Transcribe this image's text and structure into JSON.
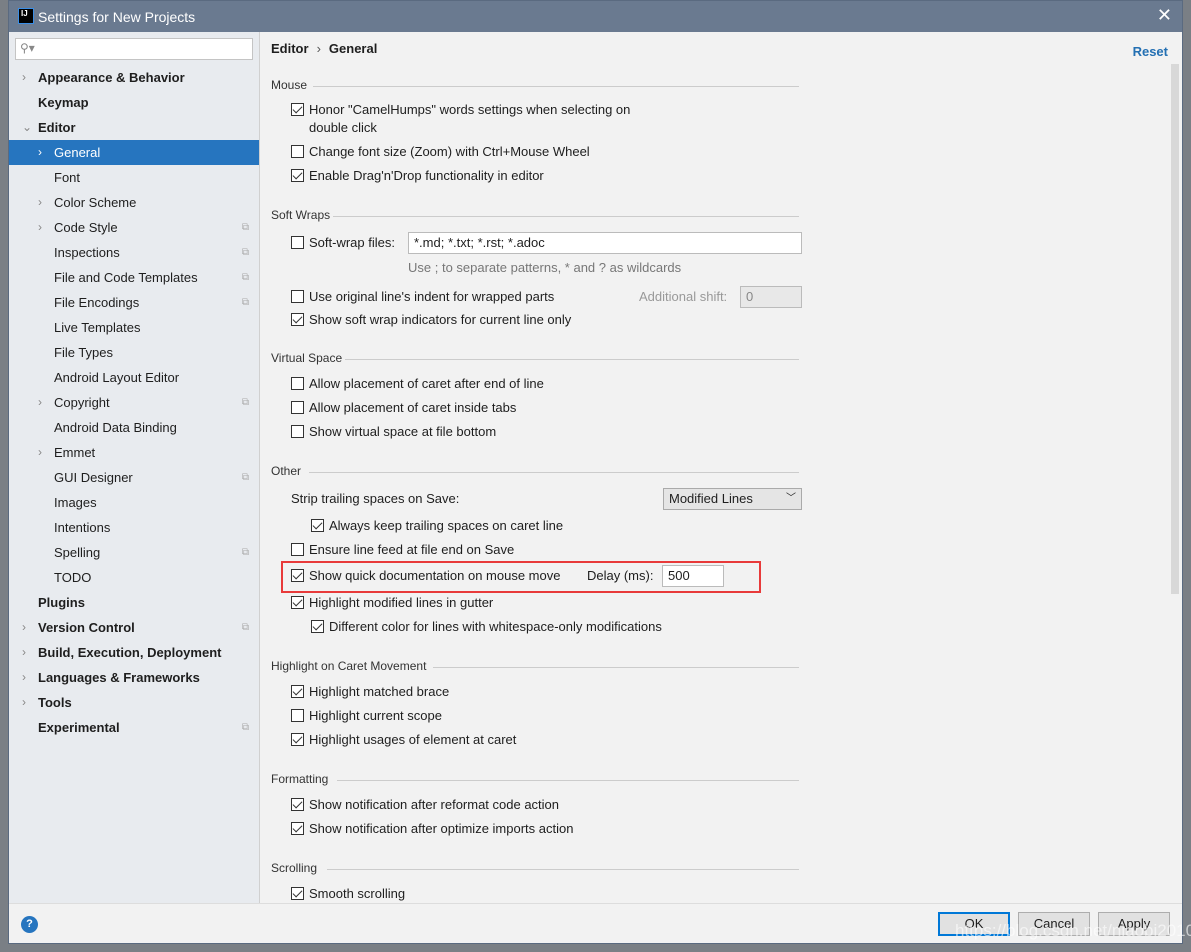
{
  "window": {
    "title": "Settings for New Projects",
    "logo": "IJ",
    "close": "✕"
  },
  "search": {
    "placeholder": "",
    "icon": "search-icon"
  },
  "sidebar": {
    "items": [
      {
        "label": "Appearance & Behavior",
        "bold": true,
        "arrow": "›",
        "level": 0
      },
      {
        "label": "Keymap",
        "bold": true,
        "arrow": "",
        "level": 0
      },
      {
        "label": "Editor",
        "bold": true,
        "arrow": "⌄",
        "level": 0
      },
      {
        "label": "General",
        "arrow": "›",
        "level": 1,
        "selected": true
      },
      {
        "label": "Font",
        "arrow": "",
        "level": 1
      },
      {
        "label": "Color Scheme",
        "arrow": "›",
        "level": 1
      },
      {
        "label": "Code Style",
        "arrow": "›",
        "level": 1,
        "cfg": true
      },
      {
        "label": "Inspections",
        "arrow": "",
        "level": 1,
        "cfg": true
      },
      {
        "label": "File and Code Templates",
        "arrow": "",
        "level": 1,
        "cfg": true
      },
      {
        "label": "File Encodings",
        "arrow": "",
        "level": 1,
        "cfg": true
      },
      {
        "label": "Live Templates",
        "arrow": "",
        "level": 1
      },
      {
        "label": "File Types",
        "arrow": "",
        "level": 1
      },
      {
        "label": "Android Layout Editor",
        "arrow": "",
        "level": 1
      },
      {
        "label": "Copyright",
        "arrow": "›",
        "level": 1,
        "cfg": true
      },
      {
        "label": "Android Data Binding",
        "arrow": "",
        "level": 1
      },
      {
        "label": "Emmet",
        "arrow": "›",
        "level": 1
      },
      {
        "label": "GUI Designer",
        "arrow": "",
        "level": 1,
        "cfg": true
      },
      {
        "label": "Images",
        "arrow": "",
        "level": 1
      },
      {
        "label": "Intentions",
        "arrow": "",
        "level": 1
      },
      {
        "label": "Spelling",
        "arrow": "",
        "level": 1,
        "cfg": true
      },
      {
        "label": "TODO",
        "arrow": "",
        "level": 1
      },
      {
        "label": "Plugins",
        "bold": true,
        "arrow": "",
        "level": 0
      },
      {
        "label": "Version Control",
        "bold": true,
        "arrow": "›",
        "level": 0,
        "cfg": true
      },
      {
        "label": "Build, Execution, Deployment",
        "bold": true,
        "arrow": "›",
        "level": 0
      },
      {
        "label": "Languages & Frameworks",
        "bold": true,
        "arrow": "›",
        "level": 0
      },
      {
        "label": "Tools",
        "bold": true,
        "arrow": "›",
        "level": 0
      },
      {
        "label": "Experimental",
        "bold": true,
        "arrow": "",
        "level": 0,
        "cfg": true
      }
    ]
  },
  "main": {
    "breadcrumb": [
      "Editor",
      "General"
    ],
    "reset": "Reset",
    "sections": {
      "mouse": "Mouse",
      "soft_wraps": "Soft Wraps",
      "virtual_space": "Virtual Space",
      "other": "Other",
      "caret": "Highlight on Caret Movement",
      "formatting": "Formatting",
      "scrolling": "Scrolling"
    },
    "mouse": [
      {
        "label": "Honor \"CamelHumps\" words settings when selecting on",
        "label2": "double click",
        "checked": true
      },
      {
        "label": "Change font size (Zoom) with Ctrl+Mouse Wheel",
        "checked": false
      },
      {
        "label": "Enable Drag'n'Drop functionality in editor",
        "checked": true
      }
    ],
    "soft_wraps": {
      "files": {
        "label": "Soft-wrap files:",
        "checked": false,
        "value": "*.md; *.txt; *.rst; *.adoc",
        "hint": "Use ; to separate patterns, * and ? as wildcards"
      },
      "indent": {
        "label": "Use original line's indent for wrapped parts",
        "checked": false,
        "shift_label": "Additional shift:",
        "shift_value": "0"
      },
      "indicators": {
        "label": "Show soft wrap indicators for current line only",
        "checked": true
      }
    },
    "virtual_space": [
      {
        "label": "Allow placement of caret after end of line",
        "checked": false
      },
      {
        "label": "Allow placement of caret inside tabs",
        "checked": false
      },
      {
        "label": "Show virtual space at file bottom",
        "checked": false
      }
    ],
    "other": {
      "strip_label": "Strip trailing spaces on Save:",
      "strip_value": "Modified Lines",
      "keep": {
        "label": "Always keep trailing spaces on caret line",
        "checked": true
      },
      "linefeed": {
        "label": "Ensure line feed at file end on Save",
        "checked": false
      },
      "quickdoc": {
        "label": "Show quick documentation on mouse move",
        "checked": true,
        "delay_label": "Delay (ms):",
        "delay_value": "500"
      },
      "modified": {
        "label": "Highlight modified lines in gutter",
        "checked": true
      },
      "whitespace": {
        "label": "Different color for lines with whitespace-only modifications",
        "checked": true
      }
    },
    "caret": [
      {
        "label": "Highlight matched brace",
        "checked": true
      },
      {
        "label": "Highlight current scope",
        "checked": false
      },
      {
        "label": "Highlight usages of element at caret",
        "checked": true
      }
    ],
    "formatting": [
      {
        "label": "Show notification after reformat code action",
        "checked": true
      },
      {
        "label": "Show notification after optimize imports action",
        "checked": true
      }
    ],
    "scrolling": [
      {
        "label": "Smooth scrolling",
        "checked": true
      }
    ]
  },
  "footer": {
    "help": "?",
    "ok": "OK",
    "cancel": "Cancel",
    "apply": "Apply"
  },
  "watermark": "https://blog.csdn.net/niaobi2010"
}
